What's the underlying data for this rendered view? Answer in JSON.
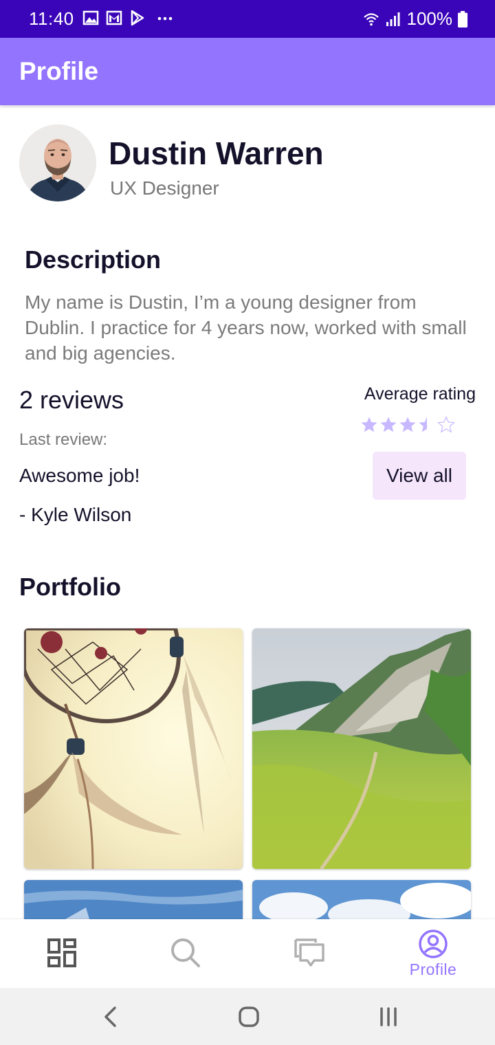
{
  "status_bar": {
    "time": "11:40",
    "battery": "100%",
    "left_icons": [
      "image-icon",
      "gmail-icon",
      "play-store-icon",
      "more-dots-icon"
    ],
    "right_icons": [
      "wifi-icon",
      "signal-icon",
      "battery-icon"
    ]
  },
  "app_bar": {
    "title": "Profile"
  },
  "profile": {
    "name": "Dustin Warren",
    "role": "UX Designer"
  },
  "description": {
    "title": "Description",
    "text": "My name is Dustin, I’m a young designer from Dublin. I practice for 4 years now, worked with small and big agencies."
  },
  "reviews": {
    "count_label": "2 reviews",
    "last_review_label": "Last review:",
    "last_review_text": "Awesome job!",
    "last_review_author": "- Kyle Wilson",
    "average_label": "Average rating",
    "rating": 3.5,
    "rating_max": 5,
    "view_all_label": "View all"
  },
  "portfolio": {
    "title": "Portfolio",
    "images": [
      "dreamcatcher-image",
      "mountain-meadow-image",
      "sky-image",
      "clouds-image"
    ]
  },
  "bottom_nav": {
    "items": [
      {
        "icon": "dashboard-icon",
        "label": ""
      },
      {
        "icon": "search-icon",
        "label": ""
      },
      {
        "icon": "chat-icon",
        "label": ""
      },
      {
        "icon": "profile-icon",
        "label": "Profile"
      }
    ],
    "active_color": "#9374ff",
    "inactive_color": "#8a8a8a"
  },
  "colors": {
    "status_bar": "#3a05b8",
    "app_bar": "#9374ff",
    "star": "#c8b8ff",
    "view_all_bg": "#f6e6fb"
  }
}
